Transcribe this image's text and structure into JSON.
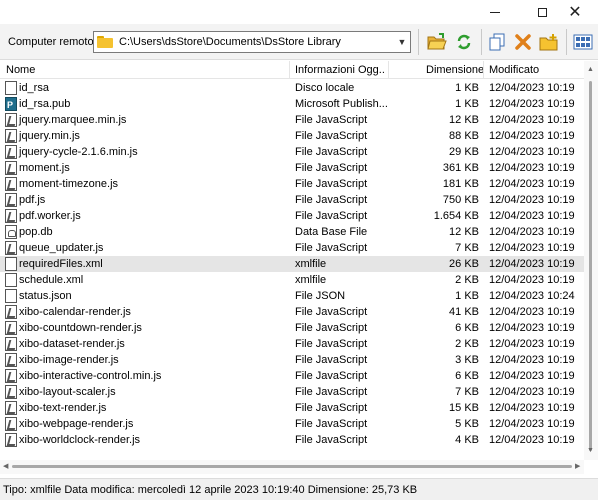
{
  "toolbar": {
    "label": "Computer remoto",
    "path": "C:\\Users\\dsStore\\Documents\\DsStore Library"
  },
  "columns": {
    "name": "Nome",
    "info": "Informazioni Ogg...",
    "size": "Dimensione",
    "modified": "Modificato"
  },
  "files": [
    {
      "name": "id_rsa",
      "type": "Disco locale",
      "size": "1 KB",
      "date": "12/04/2023 10:19",
      "icon": "doc"
    },
    {
      "name": "id_rsa.pub",
      "type": "Microsoft Publish...",
      "size": "1 KB",
      "date": "12/04/2023 10:19",
      "icon": "pub"
    },
    {
      "name": "jquery.marquee.min.js",
      "type": "File JavaScript",
      "size": "12 KB",
      "date": "12/04/2023 10:19",
      "icon": "js"
    },
    {
      "name": "jquery.min.js",
      "type": "File JavaScript",
      "size": "88 KB",
      "date": "12/04/2023 10:19",
      "icon": "js"
    },
    {
      "name": "jquery-cycle-2.1.6.min.js",
      "type": "File JavaScript",
      "size": "29 KB",
      "date": "12/04/2023 10:19",
      "icon": "js"
    },
    {
      "name": "moment.js",
      "type": "File JavaScript",
      "size": "361 KB",
      "date": "12/04/2023 10:19",
      "icon": "js"
    },
    {
      "name": "moment-timezone.js",
      "type": "File JavaScript",
      "size": "181 KB",
      "date": "12/04/2023 10:19",
      "icon": "js"
    },
    {
      "name": "pdf.js",
      "type": "File JavaScript",
      "size": "750 KB",
      "date": "12/04/2023 10:19",
      "icon": "js"
    },
    {
      "name": "pdf.worker.js",
      "type": "File JavaScript",
      "size": "1.654 KB",
      "date": "12/04/2023 10:19",
      "icon": "js"
    },
    {
      "name": "pop.db",
      "type": "Data Base File",
      "size": "12 KB",
      "date": "12/04/2023 10:19",
      "icon": "db"
    },
    {
      "name": "queue_updater.js",
      "type": "File JavaScript",
      "size": "7 KB",
      "date": "12/04/2023 10:19",
      "icon": "js"
    },
    {
      "name": "requiredFiles.xml",
      "type": "xmlfile",
      "size": "26 KB",
      "date": "12/04/2023 10:19",
      "icon": "doc",
      "selected": true
    },
    {
      "name": "schedule.xml",
      "type": "xmlfile",
      "size": "2 KB",
      "date": "12/04/2023 10:19",
      "icon": "doc"
    },
    {
      "name": "status.json",
      "type": "File JSON",
      "size": "1 KB",
      "date": "12/04/2023 10:24",
      "icon": "doc"
    },
    {
      "name": "xibo-calendar-render.js",
      "type": "File JavaScript",
      "size": "41 KB",
      "date": "12/04/2023 10:19",
      "icon": "js"
    },
    {
      "name": "xibo-countdown-render.js",
      "type": "File JavaScript",
      "size": "6 KB",
      "date": "12/04/2023 10:19",
      "icon": "js"
    },
    {
      "name": "xibo-dataset-render.js",
      "type": "File JavaScript",
      "size": "2 KB",
      "date": "12/04/2023 10:19",
      "icon": "js"
    },
    {
      "name": "xibo-image-render.js",
      "type": "File JavaScript",
      "size": "3 KB",
      "date": "12/04/2023 10:19",
      "icon": "js"
    },
    {
      "name": "xibo-interactive-control.min.js",
      "type": "File JavaScript",
      "size": "6 KB",
      "date": "12/04/2023 10:19",
      "icon": "js"
    },
    {
      "name": "xibo-layout-scaler.js",
      "type": "File JavaScript",
      "size": "7 KB",
      "date": "12/04/2023 10:19",
      "icon": "js"
    },
    {
      "name": "xibo-text-render.js",
      "type": "File JavaScript",
      "size": "15 KB",
      "date": "12/04/2023 10:19",
      "icon": "js"
    },
    {
      "name": "xibo-webpage-render.js",
      "type": "File JavaScript",
      "size": "5 KB",
      "date": "12/04/2023 10:19",
      "icon": "js"
    },
    {
      "name": "xibo-worldclock-render.js",
      "type": "File JavaScript",
      "size": "4 KB",
      "date": "12/04/2023 10:19",
      "icon": "js"
    }
  ],
  "status": {
    "text": "Tipo: xmlfile Data modifica: mercoledì 12 aprile 2023 10:19:40 Dimensione: 25,73 KB"
  },
  "icons": {
    "folder": "folder-icon",
    "open_folder": "open-folder-icon",
    "refresh": "refresh-icon",
    "copy": "copy-icon",
    "delete": "delete-icon",
    "new_folder": "new-folder-icon",
    "view": "view-grid-icon"
  }
}
